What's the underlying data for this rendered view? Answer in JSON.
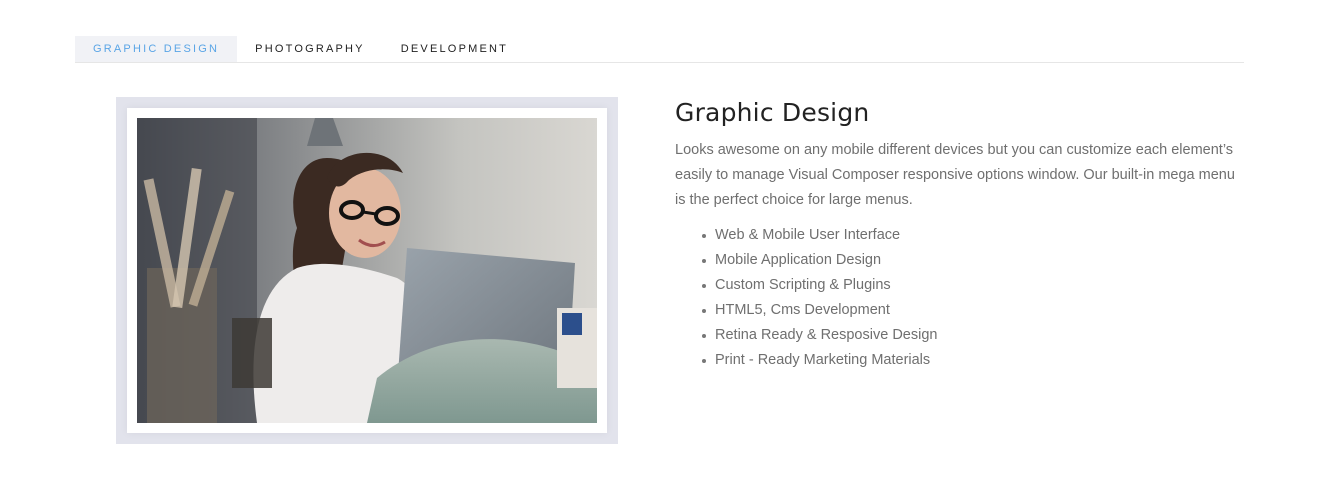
{
  "tabs": [
    {
      "label": "GRAPHIC DESIGN",
      "active": true
    },
    {
      "label": "PHOTOGRAPHY",
      "active": false
    },
    {
      "label": "DEVELOPMENT",
      "active": false
    }
  ],
  "colors": {
    "accent": "#5aa5e6",
    "active_tab_bg": "#f1f2f6",
    "frame": "#e2e3ec",
    "heading": "#222222",
    "body_text": "#6f6f6f"
  },
  "panel": {
    "title": "Graphic Design",
    "description": "Looks awesome on any mobile different devices but you can customize each element’s easily to manage Visual Composer responsive options window. Our built-in mega menu is the perfect choice for large menus.",
    "features": [
      "Web & Mobile User Interface",
      "Mobile Application Design",
      "Custom Scripting & Plugins",
      "HTML5, Cms Development",
      "Retina Ready & Resposive Design",
      "Print - Ready Marketing Materials"
    ]
  }
}
